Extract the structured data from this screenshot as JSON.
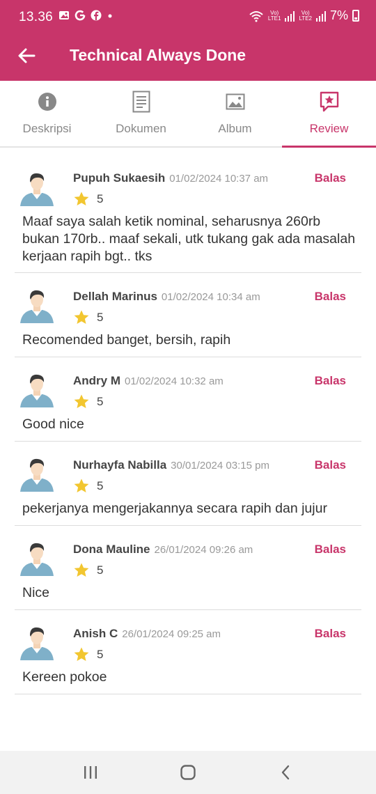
{
  "status_bar": {
    "time": "13.36",
    "left_icons": [
      "gallery-icon",
      "google-icon",
      "facebook-icon",
      "dot-icon"
    ],
    "sim1": "LTE1",
    "sim2": "LTE2",
    "volte": "Vo)",
    "battery": "7%"
  },
  "header": {
    "title": "Technical Always Done",
    "back_icon": "arrow-left-icon"
  },
  "tabs": [
    {
      "label": "Deskripsi",
      "icon": "info-icon",
      "active": false
    },
    {
      "label": "Dokumen",
      "icon": "document-icon",
      "active": false
    },
    {
      "label": "Album",
      "icon": "image-icon",
      "active": false
    },
    {
      "label": "Review",
      "icon": "review-star-icon",
      "active": true
    }
  ],
  "colors": {
    "brand": "#c8356a",
    "star": "#f2c630",
    "inactive_tab": "#888888"
  },
  "reviews": [
    {
      "name": "Pupuh Sukaesih",
      "date": "01/02/2024 10:37 am",
      "rating": "5",
      "reply": "Balas",
      "text": "Maaf saya salah ketik nominal, seharusnya 260rb bukan 170rb.. maaf sekali, utk tukang gak ada masalah kerjaan rapih bgt.. tks"
    },
    {
      "name": "Dellah Marinus",
      "date": "01/02/2024 10:34 am",
      "rating": "5",
      "reply": "Balas",
      "text": "Recomended banget, bersih, rapih"
    },
    {
      "name": "Andry M",
      "date": "01/02/2024 10:32 am",
      "rating": "5",
      "reply": "Balas",
      "text": "Good nice"
    },
    {
      "name": "Nurhayfa Nabilla",
      "date": "30/01/2024 03:15 pm",
      "rating": "5",
      "reply": "Balas",
      "text": "pekerjanya mengerjakannya secara rapih dan jujur"
    },
    {
      "name": "Dona Mauline",
      "date": "26/01/2024 09:26 am",
      "rating": "5",
      "reply": "Balas",
      "text": "Nice"
    },
    {
      "name": "Anish C",
      "date": "26/01/2024 09:25 am",
      "rating": "5",
      "reply": "Balas",
      "text": "Kereen pokoe"
    }
  ],
  "nav_bar": [
    "recent-apps-icon",
    "home-icon",
    "back-icon"
  ]
}
